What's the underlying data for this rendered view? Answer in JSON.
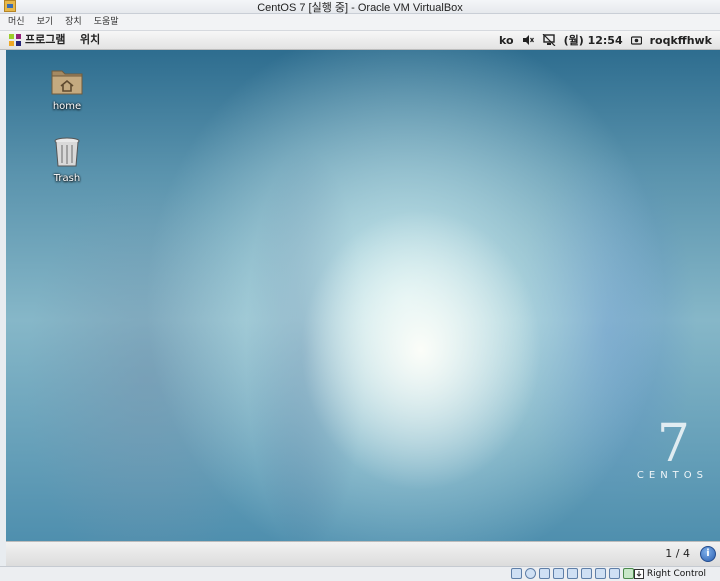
{
  "window": {
    "title": "CentOS 7 [실행 중] - Oracle VM VirtualBox"
  },
  "host_menu": {
    "items": [
      "머신",
      "보기",
      "장치",
      "도움말"
    ]
  },
  "guest_panel": {
    "applications": "프로그램",
    "places": "위치",
    "keyboard": "ko",
    "clock": "(월) 12:54",
    "user": "roqkffhwk"
  },
  "desktop": {
    "icons": [
      {
        "label": "home",
        "icon": "folder-home-icon"
      },
      {
        "label": "Trash",
        "icon": "trash-icon"
      }
    ],
    "branding": {
      "number": "7",
      "name": "CENTOS"
    }
  },
  "bottom_panel": {
    "workspace": "1 / 4"
  },
  "host_status": {
    "host_key": "Right Control"
  },
  "colors": {
    "panel": "#e9e9e9",
    "desktop_accent": "#5a93ad"
  }
}
